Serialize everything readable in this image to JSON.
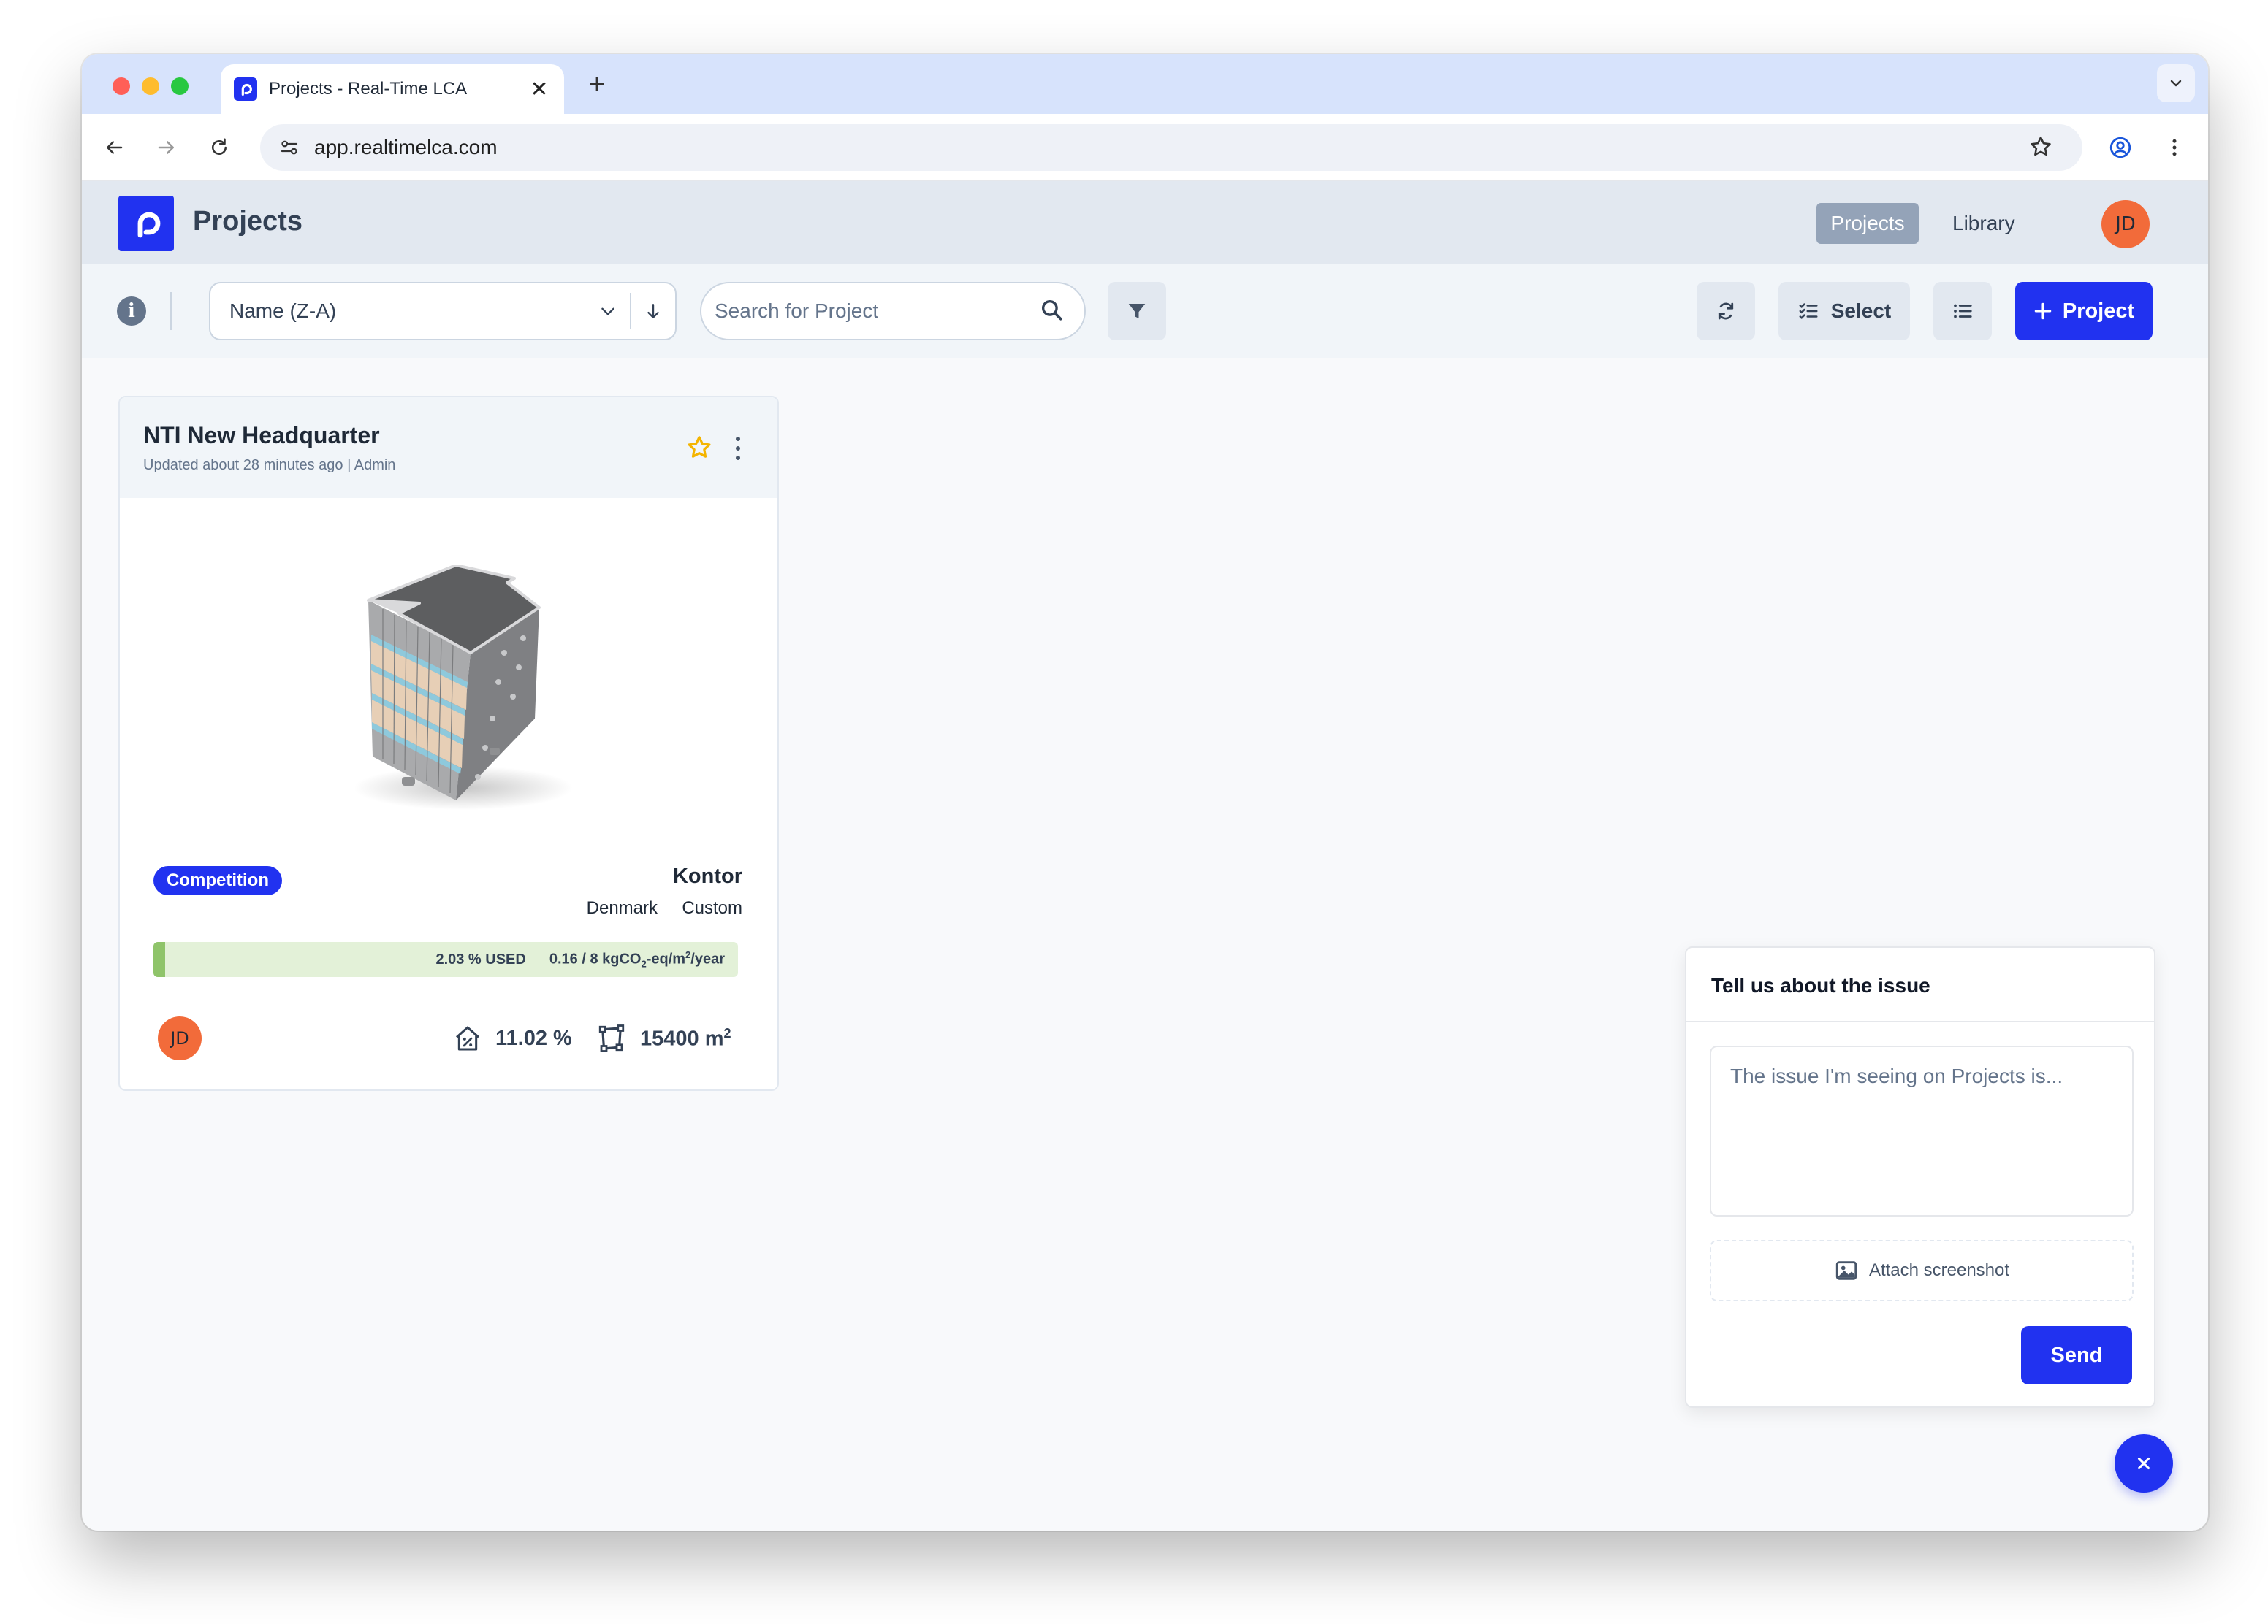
{
  "browser": {
    "tab_title": "Projects - Real-Time LCA",
    "tab_close": "✕",
    "new_tab": "+",
    "url": "app.realtimelca.com"
  },
  "header": {
    "title": "Projects",
    "nav": {
      "projects": "Projects",
      "library": "Library"
    },
    "avatar_initials": "JD"
  },
  "toolbar": {
    "sort_value": "Name (Z-A)",
    "search_placeholder": "Search for Project",
    "select_label": "Select",
    "new_project_label": "Project"
  },
  "project_card": {
    "title": "NTI New Headquarter",
    "subtitle": "Updated about 28 minutes ago | Admin",
    "badge": "Competition",
    "type": "Kontor",
    "country": "Denmark",
    "custom": "Custom",
    "usage_fraction": 0.0203,
    "usage_label": "2.03 % USED",
    "budget_value": "0.16 / 8 kgCO",
    "budget_sub": "2",
    "budget_suffix": "-eq/m",
    "budget_sup": "2",
    "budget_end": "/year",
    "avatar_initials": "JD",
    "percent": "11.02 %",
    "area": "15400 m",
    "area_sup": "2"
  },
  "feedback": {
    "title": "Tell us about the issue",
    "placeholder": "The issue I'm seeing on Projects is...",
    "attach_label": "Attach screenshot",
    "send_label": "Send"
  },
  "colors": {
    "accent": "#2132f0",
    "avatar": "#f26b3a",
    "usage_fill": "#8fc46a",
    "usage_track": "#e3f1d8",
    "star": "#f4b400"
  }
}
